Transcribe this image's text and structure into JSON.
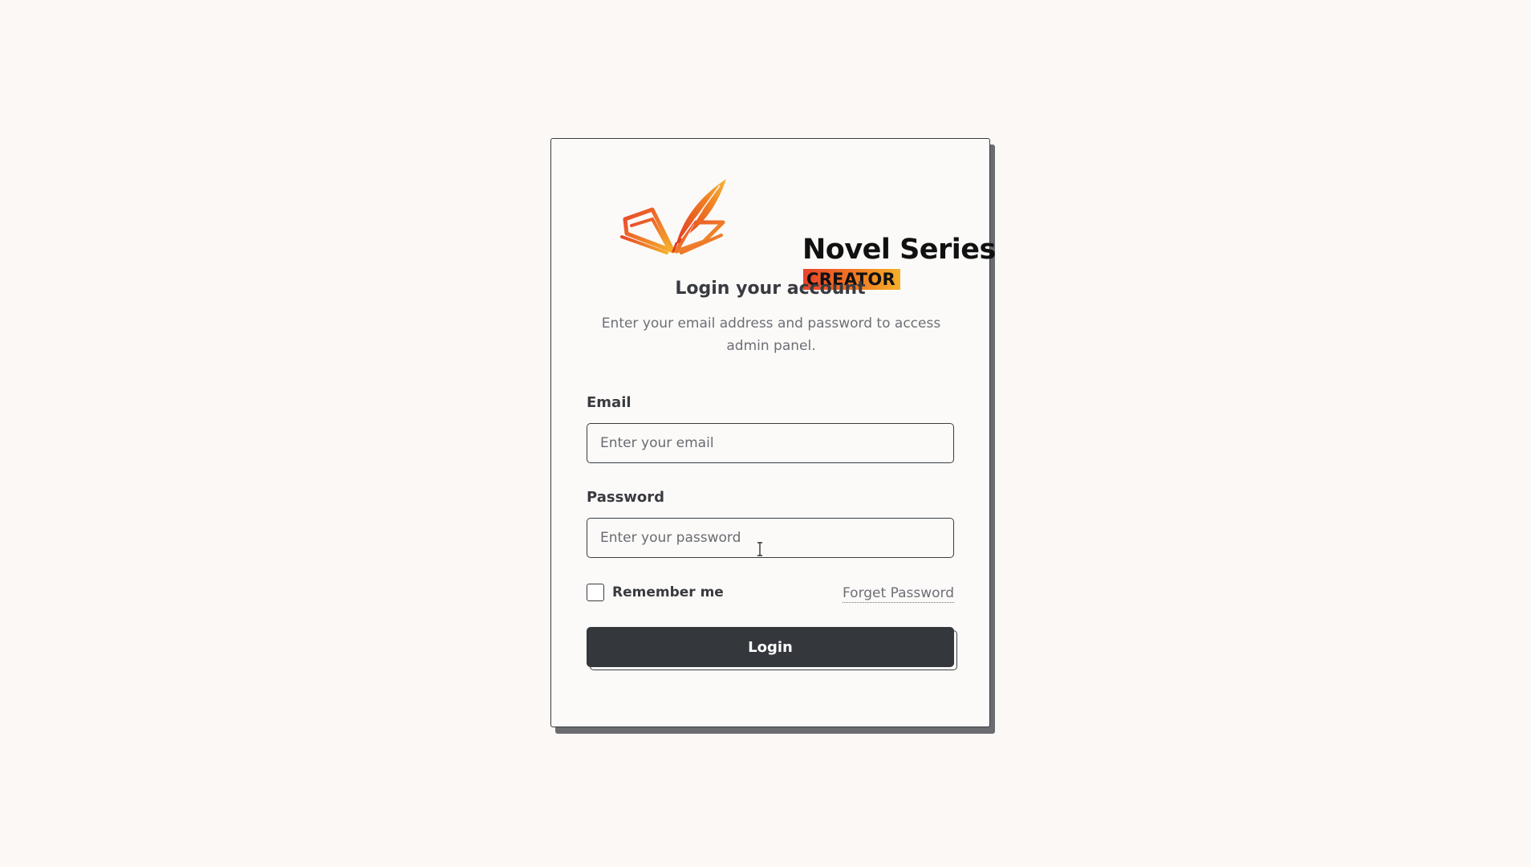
{
  "brand": {
    "title": "Novel Series",
    "subtitle": "CREATOR"
  },
  "form": {
    "heading": "Login your account",
    "description": "Enter your email address and password to access admin panel.",
    "email": {
      "label": "Email",
      "placeholder": "Enter your email",
      "value": ""
    },
    "password": {
      "label": "Password",
      "placeholder": "Enter your password",
      "value": ""
    },
    "remember": {
      "label": "Remember me",
      "checked": false
    },
    "forgot_label": "Forget Password",
    "login_label": "Login"
  },
  "icons": {
    "logo": "open-book-quill-icon",
    "cursor": "text-cursor-icon"
  },
  "colors": {
    "background": "#fbf8f5",
    "card": "#fbfaf8",
    "button": "#34373c",
    "text": "#3a3b40",
    "muted": "#6e6f76",
    "brand_orange": "#f07a22",
    "brand_red": "#e8442a"
  }
}
